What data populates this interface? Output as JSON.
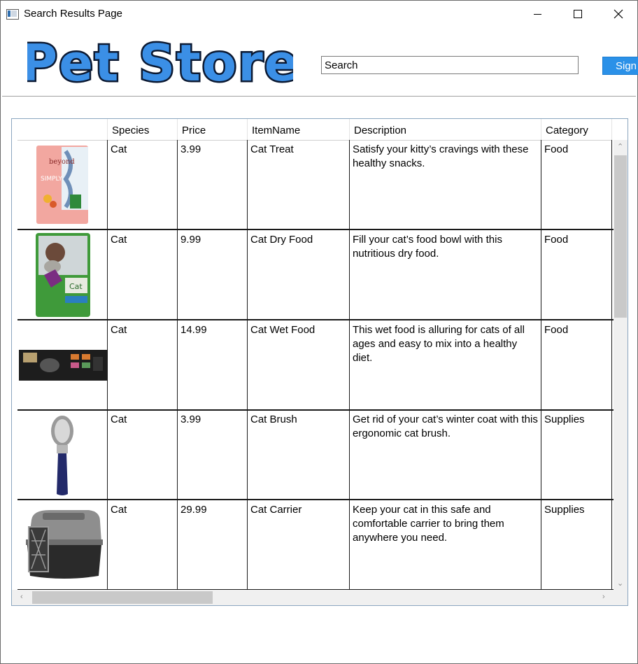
{
  "window": {
    "title": "Search Results Page"
  },
  "header": {
    "logo_text": "Pet Store",
    "search_value": "Search",
    "signin_label": "Sign"
  },
  "grid": {
    "columns": [
      "",
      "Species",
      "Price",
      "ItemName",
      "Description",
      "Category"
    ],
    "rows": [
      {
        "image": "cat-treat-bag",
        "species": "Cat",
        "price": "3.99",
        "item": "Cat Treat",
        "description": "Satisfy your kitty’s cravings with these healthy snacks.",
        "category": "Food"
      },
      {
        "image": "cat-dry-food-bag",
        "species": "Cat",
        "price": "9.99",
        "item": "Cat Dry Food",
        "description": "Fill your cat’s food bowl with this nutritious dry food.",
        "category": "Food"
      },
      {
        "image": "cat-wet-food-pack",
        "species": "Cat",
        "price": "14.99",
        "item": "Cat Wet Food",
        "description": "This wet food is alluring for cats of all ages and easy to mix into a healthy diet.",
        "category": "Food"
      },
      {
        "image": "cat-brush",
        "species": "Cat",
        "price": "3.99",
        "item": "Cat Brush",
        "description": "Get rid of your cat’s winter coat with this ergonomic cat brush.",
        "category": "Supplies"
      },
      {
        "image": "cat-carrier",
        "species": "Cat",
        "price": "29.99",
        "item": "Cat Carrier",
        "description": "Keep your cat in this safe and comfortable carrier to bring them anywhere you need.",
        "category": "Supplies"
      }
    ]
  },
  "colors": {
    "accent": "#2b91e8",
    "logo_fill": "#3b8fe6",
    "logo_outline": "#0c1a33"
  }
}
